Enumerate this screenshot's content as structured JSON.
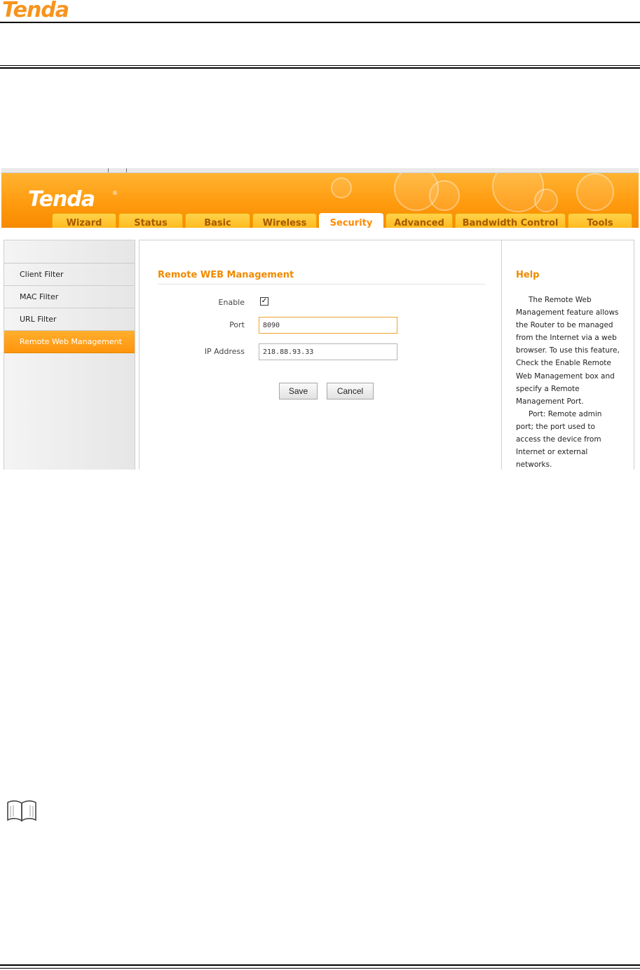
{
  "doc": {
    "header_logo": "Tenda",
    "note_icon": "book-icon"
  },
  "router_ui": {
    "brand": "Tenda",
    "brand_mark": "®",
    "tabs": [
      {
        "label": "Wizard",
        "active": false
      },
      {
        "label": "Status",
        "active": false
      },
      {
        "label": "Basic",
        "active": false
      },
      {
        "label": "Wireless",
        "active": false
      },
      {
        "label": "Security",
        "active": true
      },
      {
        "label": "Advanced",
        "active": false
      },
      {
        "label": "Bandwidth Control",
        "active": false
      },
      {
        "label": "Tools",
        "active": false
      }
    ],
    "sidebar": {
      "items": [
        {
          "label": "Client Filter",
          "active": false
        },
        {
          "label": "MAC Filter",
          "active": false
        },
        {
          "label": "URL Filter",
          "active": false
        },
        {
          "label": "Remote Web Management",
          "active": true
        }
      ]
    },
    "main": {
      "title": "Remote WEB Management",
      "enable_label": "Enable",
      "enable_checked": true,
      "port_label": "Port",
      "port_value": "8090",
      "ip_label": "IP Address",
      "ip_value": "218.88.93.33",
      "save_label": "Save",
      "cancel_label": "Cancel"
    },
    "help": {
      "title": "Help",
      "paragraphs": [
        "The Remote Web Management feature allows the Router to be managed from the Internet via a web browser. To use this feature, Check the Enable Remote Web Management box and specify a Remote Management Port.",
        "Port: Remote admin port; the port used to access the device from Internet or external networks."
      ]
    },
    "colors": {
      "accent": "#f08a00",
      "banner": "#ff9b0f",
      "active_menu": "#ff950c"
    }
  }
}
